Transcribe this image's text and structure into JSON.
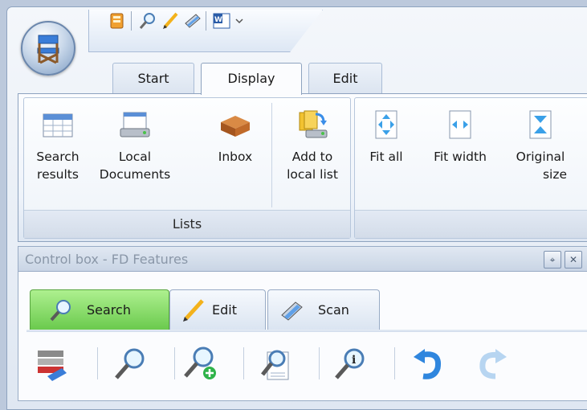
{
  "quick_access": {
    "icons": [
      "open-file-icon",
      "search-icon",
      "edit-pencil-icon",
      "scan-icon",
      "word-document-icon",
      "customize-dropdown-icon"
    ]
  },
  "tabs": [
    {
      "label": "Start"
    },
    {
      "label": "Display"
    },
    {
      "label": "Edit"
    }
  ],
  "ribbon": {
    "lists_group": {
      "label": "Lists",
      "buttons": [
        {
          "line1": "Search",
          "line2": "results",
          "icon": "table-icon"
        },
        {
          "line1": "Local",
          "line2": "Documents",
          "icon": "local-documents-icon"
        },
        {
          "line1": "Inbox",
          "line2": "",
          "icon": "inbox-tray-icon"
        },
        {
          "line1": "Add to",
          "line2": "local list",
          "icon": "add-to-local-list-icon"
        }
      ]
    },
    "view_group": {
      "label": "",
      "buttons": [
        {
          "line1": "Fit all",
          "line2": "",
          "icon": "fit-all-icon"
        },
        {
          "line1": "Fit width",
          "line2": "",
          "icon": "fit-width-icon"
        },
        {
          "line1": "Original",
          "line2": "size",
          "icon": "original-size-icon"
        }
      ]
    }
  },
  "control_box": {
    "title": "Control box - FD Features",
    "pin_glyph": "⌖",
    "close_glyph": "✕",
    "tabs": [
      {
        "label": "Search",
        "icon": "search-icon",
        "active": true
      },
      {
        "label": "Edit",
        "icon": "edit-pencil-icon",
        "active": false
      },
      {
        "label": "Scan",
        "icon": "scanner-icon",
        "active": false
      }
    ],
    "toolbar": [
      "document-stack-icon",
      "search-icon",
      "add-search-icon",
      "search-document-icon",
      "search-info-icon",
      "undo-icon",
      "redo-icon"
    ]
  },
  "colors": {
    "accent": "#69c94c",
    "border": "#8ea3bf"
  }
}
